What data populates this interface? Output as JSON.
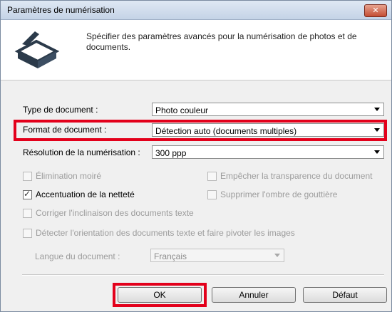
{
  "window": {
    "title": "Paramètres de numérisation",
    "close_glyph": "✕"
  },
  "header": {
    "icon": "scanner-icon",
    "description": "Spécifier des paramètres avancés pour la numérisation de photos et de documents."
  },
  "fields": {
    "doc_type": {
      "label": "Type de document :",
      "value": "Photo couleur"
    },
    "doc_format": {
      "label": "Format de document :",
      "value": "Détection auto (documents multiples)"
    },
    "resolution": {
      "label": "Résolution de la numérisation :",
      "value": "300 ppp"
    }
  },
  "options": {
    "moire": {
      "label": "Élimination moiré",
      "checked": false,
      "enabled": false
    },
    "sharpen": {
      "label": "Accentuation de la netteté",
      "checked": true,
      "enabled": true
    },
    "prevent_show_through": {
      "label": "Empêcher la transparence du document",
      "checked": false,
      "enabled": false
    },
    "gutter_shadow": {
      "label": "Supprimer l'ombre de gouttière",
      "checked": false,
      "enabled": false
    },
    "skew": {
      "label": "Corriger l'inclinaison des documents texte",
      "checked": false,
      "enabled": false
    },
    "orientation": {
      "label": "Détecter l'orientation des documents texte et faire pivoter les images",
      "checked": false,
      "enabled": false
    }
  },
  "language": {
    "label": "Langue du document :",
    "value": "Français"
  },
  "buttons": {
    "ok": "OK",
    "cancel": "Annuler",
    "default": "Défaut"
  },
  "colors": {
    "highlight": "#e3001b",
    "title_bar": "#c4d3e6",
    "close_button": "#c44d33"
  }
}
